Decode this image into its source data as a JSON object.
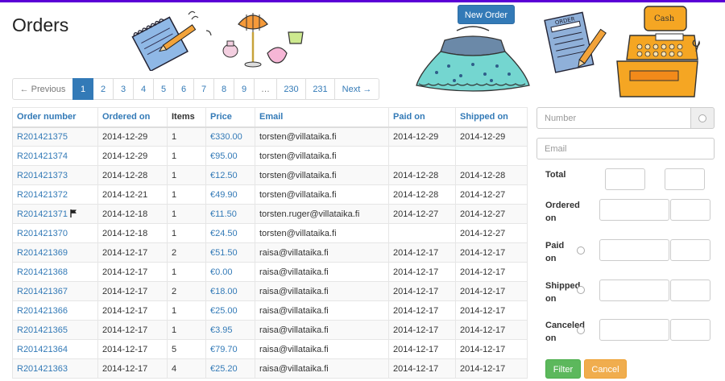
{
  "page": {
    "title": "Orders",
    "new_order_label": "New Order"
  },
  "pagination": {
    "items": [
      {
        "label": "← Previous",
        "state": "disabled"
      },
      {
        "label": "1",
        "state": "active"
      },
      {
        "label": "2",
        "state": ""
      },
      {
        "label": "3",
        "state": ""
      },
      {
        "label": "4",
        "state": ""
      },
      {
        "label": "5",
        "state": ""
      },
      {
        "label": "6",
        "state": ""
      },
      {
        "label": "7",
        "state": ""
      },
      {
        "label": "8",
        "state": ""
      },
      {
        "label": "9",
        "state": ""
      },
      {
        "label": "…",
        "state": "disabled"
      },
      {
        "label": "230",
        "state": ""
      },
      {
        "label": "231",
        "state": ""
      },
      {
        "label": "Next →",
        "state": ""
      }
    ]
  },
  "table": {
    "headers": [
      "Order number",
      "Ordered on",
      "Items",
      "Price",
      "Email",
      "Paid on",
      "Shipped on"
    ],
    "rows": [
      {
        "number": "R201421375",
        "ordered": "2014-12-29",
        "items": "1",
        "price": "€330.00",
        "email": "torsten@villataika.fi",
        "paid": "2014-12-29",
        "shipped": "2014-12-29",
        "flag": false
      },
      {
        "number": "R201421374",
        "ordered": "2014-12-29",
        "items": "1",
        "price": "€95.00",
        "email": "torsten@villataika.fi",
        "paid": "",
        "shipped": "",
        "flag": false
      },
      {
        "number": "R201421373",
        "ordered": "2014-12-28",
        "items": "1",
        "price": "€12.50",
        "email": "torsten@villataika.fi",
        "paid": "2014-12-28",
        "shipped": "2014-12-28",
        "flag": false
      },
      {
        "number": "R201421372",
        "ordered": "2014-12-21",
        "items": "1",
        "price": "€49.90",
        "email": "torsten@villataika.fi",
        "paid": "2014-12-28",
        "shipped": "2014-12-27",
        "flag": false
      },
      {
        "number": "R201421371",
        "ordered": "2014-12-18",
        "items": "1",
        "price": "€11.50",
        "email": "torsten.ruger@villataika.fi",
        "paid": "2014-12-27",
        "shipped": "2014-12-27",
        "flag": true
      },
      {
        "number": "R201421370",
        "ordered": "2014-12-18",
        "items": "1",
        "price": "€24.50",
        "email": "torsten@villataika.fi",
        "paid": "",
        "shipped": "2014-12-27",
        "flag": false
      },
      {
        "number": "R201421369",
        "ordered": "2014-12-17",
        "items": "2",
        "price": "€51.50",
        "email": "raisa@villataika.fi",
        "paid": "2014-12-17",
        "shipped": "2014-12-17",
        "flag": false
      },
      {
        "number": "R201421368",
        "ordered": "2014-12-17",
        "items": "1",
        "price": "€0.00",
        "email": "raisa@villataika.fi",
        "paid": "2014-12-17",
        "shipped": "2014-12-17",
        "flag": false
      },
      {
        "number": "R201421367",
        "ordered": "2014-12-17",
        "items": "2",
        "price": "€18.00",
        "email": "raisa@villataika.fi",
        "paid": "2014-12-17",
        "shipped": "2014-12-17",
        "flag": false
      },
      {
        "number": "R201421366",
        "ordered": "2014-12-17",
        "items": "1",
        "price": "€25.00",
        "email": "raisa@villataika.fi",
        "paid": "2014-12-17",
        "shipped": "2014-12-17",
        "flag": false
      },
      {
        "number": "R201421365",
        "ordered": "2014-12-17",
        "items": "1",
        "price": "€3.95",
        "email": "raisa@villataika.fi",
        "paid": "2014-12-17",
        "shipped": "2014-12-17",
        "flag": false
      },
      {
        "number": "R201421364",
        "ordered": "2014-12-17",
        "items": "5",
        "price": "€79.70",
        "email": "raisa@villataika.fi",
        "paid": "2014-12-17",
        "shipped": "2014-12-17",
        "flag": false
      },
      {
        "number": "R201421363",
        "ordered": "2014-12-17",
        "items": "4",
        "price": "€25.20",
        "email": "raisa@villataika.fi",
        "paid": "2014-12-17",
        "shipped": "2014-12-17",
        "flag": false
      }
    ]
  },
  "filter": {
    "number_placeholder": "Number",
    "email_placeholder": "Email",
    "total_label": "Total",
    "ordered_on_label": [
      "Ordered",
      "on"
    ],
    "paid_on_label": [
      "Paid",
      "on"
    ],
    "shipped_on_label": [
      "Shipped",
      "on"
    ],
    "canceled_on_label": [
      "Canceled",
      "on"
    ],
    "filter_button": "Filter",
    "cancel_button": "Cancel"
  },
  "illustrations": {
    "order_pad_text": "ORDER",
    "register_text": "Cash"
  },
  "colors": {
    "primary": "#337ab7",
    "success": "#5cb85c",
    "warning": "#f0ad4e",
    "topbar": "#5b00d6"
  }
}
